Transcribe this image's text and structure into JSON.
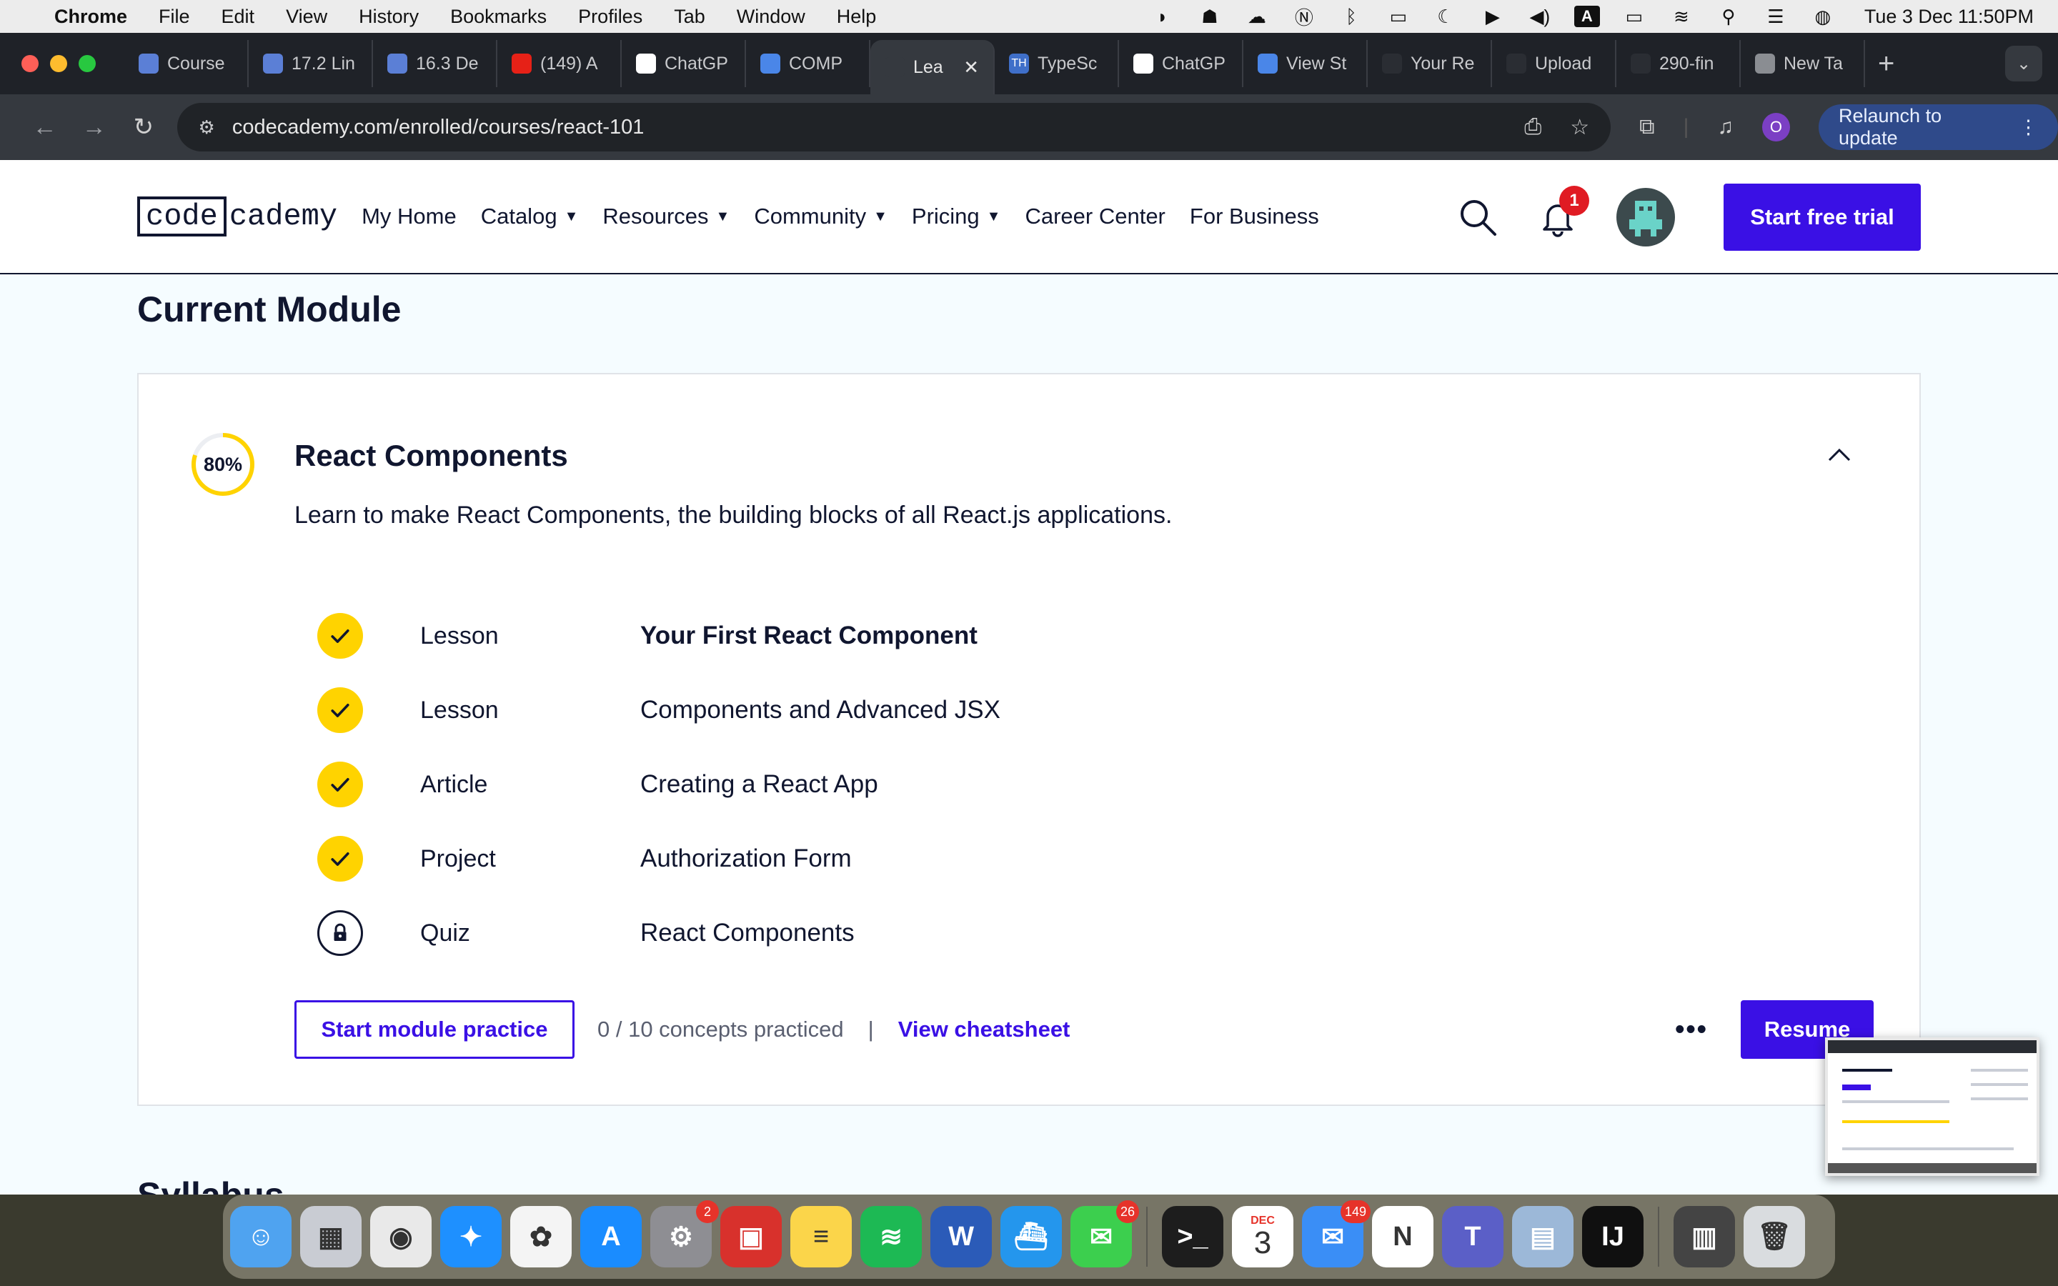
{
  "menubar": {
    "app": "Chrome",
    "items": [
      "File",
      "Edit",
      "View",
      "History",
      "Bookmarks",
      "Profiles",
      "Tab",
      "Window",
      "Help"
    ],
    "clock": "Tue 3 Dec  11:50PM",
    "status_icons": [
      "dash-icon",
      "teams-icon",
      "cloud-icon",
      "notion-icon",
      "bluetooth-icon",
      "display-icon",
      "moon-icon",
      "play-icon",
      "volume-icon",
      "keyboard-a-icon",
      "battery-icon",
      "wifi-icon",
      "spotlight-icon",
      "control-center-icon",
      "siri-icon"
    ]
  },
  "tabs": [
    {
      "label": "Course",
      "icon": "columns-icon",
      "color": "#5b7fd6"
    },
    {
      "label": "17.2 Lin",
      "icon": "columns-icon",
      "color": "#5b7fd6"
    },
    {
      "label": "16.3 De",
      "icon": "columns-icon",
      "color": "#5b7fd6"
    },
    {
      "label": "(149) A",
      "icon": "youtube-icon",
      "color": "#e62117"
    },
    {
      "label": "ChatGP",
      "icon": "openai-icon",
      "color": "#ffffff"
    },
    {
      "label": "COMP",
      "icon": "docs-icon",
      "color": "#4a86e8"
    },
    {
      "label": "Lea",
      "icon": "codecademy-icon",
      "color": "#35393f",
      "active": true
    },
    {
      "label": "TypeSc",
      "icon": "th-icon",
      "color": "#3f6fc9"
    },
    {
      "label": "ChatGP",
      "icon": "openai-icon",
      "color": "#ffffff"
    },
    {
      "label": "View St",
      "icon": "bar-chart-icon",
      "color": "#4a86e8"
    },
    {
      "label": "Your Re",
      "icon": "github-icon",
      "color": "#2a2d33"
    },
    {
      "label": "Upload",
      "icon": "github-icon",
      "color": "#2a2d33"
    },
    {
      "label": "290-fin",
      "icon": "github-icon",
      "color": "#2a2d33"
    },
    {
      "label": "New Ta",
      "icon": "chrome-icon",
      "color": "#8a8d92"
    }
  ],
  "toolbar": {
    "url": "codecademy.com/enrolled/courses/react-101",
    "relaunch_label": "Relaunch to update",
    "profile_initial": "O"
  },
  "site": {
    "logo_box": "code",
    "logo_rest": "cademy",
    "nav": [
      {
        "label": "My Home",
        "dropdown": false
      },
      {
        "label": "Catalog",
        "dropdown": true
      },
      {
        "label": "Resources",
        "dropdown": true
      },
      {
        "label": "Community",
        "dropdown": true
      },
      {
        "label": "Pricing",
        "dropdown": true
      },
      {
        "label": "Career Center",
        "dropdown": false
      },
      {
        "label": "For Business",
        "dropdown": false
      }
    ],
    "notification_count": "1",
    "trial_label": "Start free trial"
  },
  "main": {
    "section_title": "Current Module",
    "module": {
      "progress_label": "80%",
      "progress": 0.8,
      "title": "React Components",
      "description": "Learn to make React Components, the building blocks of all React.js applications.",
      "items": [
        {
          "type": "Lesson",
          "name": "Your First React Component",
          "status": "complete",
          "bold": true
        },
        {
          "type": "Lesson",
          "name": "Components and Advanced JSX",
          "status": "complete",
          "bold": false
        },
        {
          "type": "Article",
          "name": "Creating a React App",
          "status": "complete",
          "bold": false
        },
        {
          "type": "Project",
          "name": "Authorization Form",
          "status": "complete",
          "bold": false
        },
        {
          "type": "Quiz",
          "name": "React Components",
          "status": "locked",
          "bold": false
        }
      ],
      "practice_label": "Start module practice",
      "concepts_text": "0 / 10 concepts practiced",
      "separator": "|",
      "cheatsheet_label": "View cheatsheet",
      "more_label": "•••",
      "resume_label": "Resume"
    },
    "syllabus_peek": "Syllabus"
  },
  "colors": {
    "brand": "#3a10e5",
    "check": "#ffd300",
    "ink": "#10162f",
    "badge": "#e01b23"
  },
  "dock": {
    "apps": [
      {
        "name": "finder",
        "color": "#4fa3f0",
        "glyph": "☺"
      },
      {
        "name": "launchpad",
        "color": "#c9ccd3",
        "glyph": "▦"
      },
      {
        "name": "chrome",
        "color": "#e9e9e9",
        "glyph": "◉"
      },
      {
        "name": "safari",
        "color": "#1e90ff",
        "glyph": "✦"
      },
      {
        "name": "photos",
        "color": "#f4f4f4",
        "glyph": "✿"
      },
      {
        "name": "app-store",
        "color": "#1a8cff",
        "glyph": "A"
      },
      {
        "name": "system-settings",
        "color": "#8e8e93",
        "glyph": "⚙",
        "badge": "2"
      },
      {
        "name": "photo-booth",
        "color": "#d8312c",
        "glyph": "▣"
      },
      {
        "name": "notes",
        "color": "#fbd54a",
        "glyph": "≡"
      },
      {
        "name": "spotify",
        "color": "#1db954",
        "glyph": "≋"
      },
      {
        "name": "word",
        "color": "#2b5bb8",
        "glyph": "W"
      },
      {
        "name": "docker",
        "color": "#2496ed",
        "glyph": "⛴"
      },
      {
        "name": "messages",
        "color": "#3ccf4e",
        "glyph": "✉",
        "badge": "26"
      },
      {
        "name": "terminal",
        "color": "#1d1d1d",
        "glyph": ">_",
        "sep_before": true
      },
      {
        "name": "calendar",
        "color": "#ffffff",
        "glyph": "3",
        "label_top": "DEC"
      },
      {
        "name": "mail",
        "color": "#3a8ef6",
        "glyph": "✉",
        "badge": "149"
      },
      {
        "name": "notion",
        "color": "#ffffff",
        "glyph": "N"
      },
      {
        "name": "teams",
        "color": "#5b5fc7",
        "glyph": "T"
      },
      {
        "name": "preview",
        "color": "#9cb8d8",
        "glyph": "▤"
      },
      {
        "name": "intellij",
        "color": "#101010",
        "glyph": "IJ"
      },
      {
        "name": "screenshot",
        "color": "#444",
        "glyph": "▥",
        "sep_before": true
      },
      {
        "name": "trash",
        "color": "#d9dcdf",
        "glyph": "🗑"
      }
    ]
  }
}
